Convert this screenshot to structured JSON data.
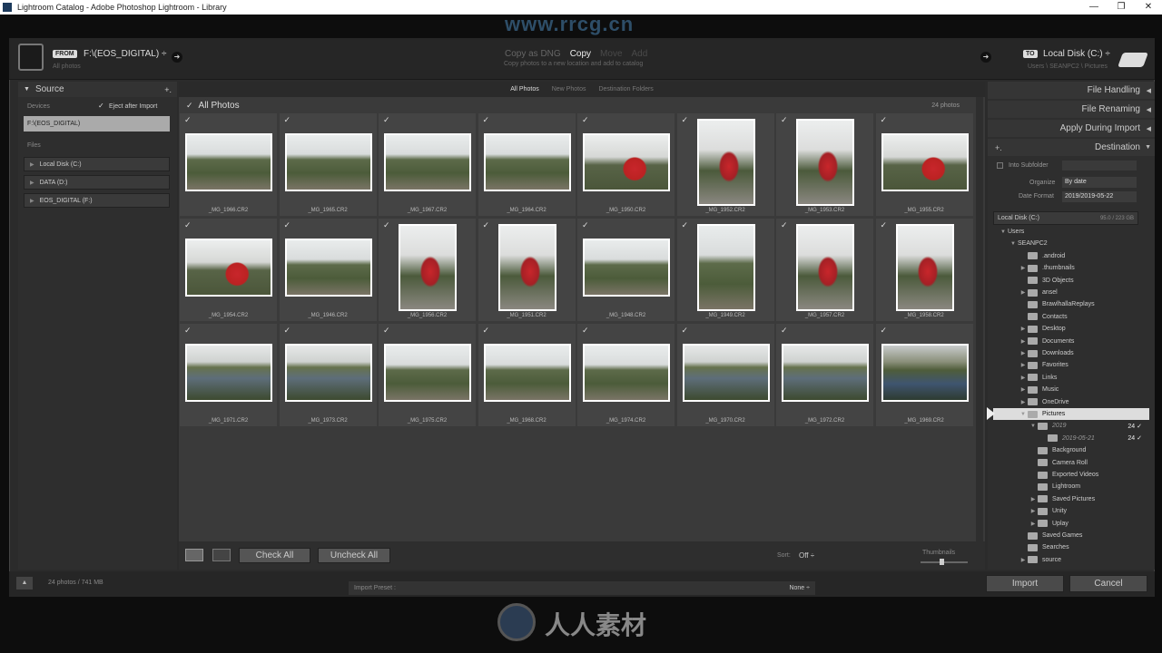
{
  "window": {
    "title": "Lightroom Catalog - Adobe Photoshop Lightroom - Library",
    "controls": [
      "—",
      "❐",
      "✕"
    ]
  },
  "watermark": {
    "top": "www.rrcg.cn",
    "bottom": "人人素材"
  },
  "topbar": {
    "from_tag": "FROM",
    "from_path": "F:\\(EOS_DIGITAL) ÷",
    "from_sub": "All photos",
    "modes": [
      "Copy as DNG",
      "Copy",
      "Move",
      "Add"
    ],
    "mode_desc": "Copy photos to a new location and add to catalog",
    "to_tag": "TO",
    "to_path": "Local Disk (C:) ÷",
    "to_sub": "Users \\ SEANPC2 \\ Pictures"
  },
  "source": {
    "title": "Source",
    "plus": "+.",
    "devices_label": "Devices",
    "eject_label": "Eject after Import",
    "selected_device": "F:\\(EOS_DIGITAL)",
    "files_label": "Files",
    "volumes": [
      "Local Disk (C:)",
      "DATA (D:)",
      "EOS_DIGITAL (F:)"
    ]
  },
  "center": {
    "tabs": [
      "All Photos",
      "New Photos",
      "Destination Folders"
    ],
    "header": "All Photos",
    "count": "24 photos",
    "photos": [
      {
        "name": "_MG_1966.CR2",
        "kind": "land",
        "look": "sky"
      },
      {
        "name": "_MG_1965.CR2",
        "kind": "land",
        "look": "sky"
      },
      {
        "name": "_MG_1967.CR2",
        "kind": "land",
        "look": "sky"
      },
      {
        "name": "_MG_1964.CR2",
        "kind": "land",
        "look": "sky"
      },
      {
        "name": "_MG_1950.CR2",
        "kind": "land",
        "look": "person"
      },
      {
        "name": "_MG_1952.CR2",
        "kind": "port",
        "look": "portp"
      },
      {
        "name": "_MG_1953.CR2",
        "kind": "port",
        "look": "portp"
      },
      {
        "name": "_MG_1955.CR2",
        "kind": "land",
        "look": "person"
      },
      {
        "name": "_MG_1954.CR2",
        "kind": "land",
        "look": "person"
      },
      {
        "name": "_MG_1946.CR2",
        "kind": "land",
        "look": "sky"
      },
      {
        "name": "_MG_1956.CR2",
        "kind": "port",
        "look": "portp"
      },
      {
        "name": "_MG_1951.CR2",
        "kind": "port",
        "look": "portp"
      },
      {
        "name": "_MG_1948.CR2",
        "kind": "land",
        "look": "sky"
      },
      {
        "name": "_MG_1949.CR2",
        "kind": "port",
        "look": "sky"
      },
      {
        "name": "_MG_1957.CR2",
        "kind": "port",
        "look": "portp"
      },
      {
        "name": "_MG_1958.CR2",
        "kind": "port",
        "look": "portp"
      },
      {
        "name": "_MG_1971.CR2",
        "kind": "land",
        "look": "lake"
      },
      {
        "name": "_MG_1973.CR2",
        "kind": "land",
        "look": "lake"
      },
      {
        "name": "_MG_1975.CR2",
        "kind": "land",
        "look": "sky"
      },
      {
        "name": "_MG_1968.CR2",
        "kind": "land",
        "look": "sky"
      },
      {
        "name": "_MG_1974.CR2",
        "kind": "land",
        "look": "sky"
      },
      {
        "name": "_MG_1970.CR2",
        "kind": "land",
        "look": "lake"
      },
      {
        "name": "_MG_1972.CR2",
        "kind": "land",
        "look": "lake"
      },
      {
        "name": "_MG_1969.CR2",
        "kind": "land",
        "look": "blue"
      }
    ],
    "check_all": "Check All",
    "uncheck_all": "Uncheck All",
    "sort_label": "Sort:",
    "sort_value": "Off ÷",
    "thumbnails_label": "Thumbnails"
  },
  "right": {
    "file_handling": "File Handling",
    "file_renaming": "File Renaming",
    "apply_during_import": "Apply During Import",
    "destination": "Destination",
    "into_subfolder": "Into Subfolder",
    "organize_label": "Organize",
    "organize_value": "By date",
    "date_format_label": "Date Format",
    "date_format_value": "2019/2019-05-22",
    "disk": "Local Disk (C:)",
    "disk_space": "95.0 / 223 GB",
    "tree": [
      {
        "label": "Users",
        "depth": 0,
        "arrow": "▼",
        "folder": false
      },
      {
        "label": "SEANPC2",
        "depth": 1,
        "arrow": "▼",
        "folder": false
      },
      {
        "label": ".android",
        "depth": 2,
        "arrow": "",
        "folder": true
      },
      {
        "label": ".thumbnails",
        "depth": 2,
        "arrow": "▶",
        "folder": true
      },
      {
        "label": "3D Objects",
        "depth": 2,
        "arrow": "",
        "folder": true
      },
      {
        "label": "ansel",
        "depth": 2,
        "arrow": "▶",
        "folder": true
      },
      {
        "label": "BrawlhallaReplays",
        "depth": 2,
        "arrow": "",
        "folder": true
      },
      {
        "label": "Contacts",
        "depth": 2,
        "arrow": "",
        "folder": true
      },
      {
        "label": "Desktop",
        "depth": 2,
        "arrow": "▶",
        "folder": true
      },
      {
        "label": "Documents",
        "depth": 2,
        "arrow": "▶",
        "folder": true
      },
      {
        "label": "Downloads",
        "depth": 2,
        "arrow": "▶",
        "folder": true
      },
      {
        "label": "Favorites",
        "depth": 2,
        "arrow": "▶",
        "folder": true
      },
      {
        "label": "Links",
        "depth": 2,
        "arrow": "▶",
        "folder": true
      },
      {
        "label": "Music",
        "depth": 2,
        "arrow": "▶",
        "folder": true
      },
      {
        "label": "OneDrive",
        "depth": 2,
        "arrow": "▶",
        "folder": true
      },
      {
        "label": "Pictures",
        "depth": 2,
        "arrow": "▼",
        "folder": true,
        "selected": true
      },
      {
        "label": "2019",
        "depth": 3,
        "arrow": "▼",
        "folder": true,
        "count": "24 ✓",
        "italic": true
      },
      {
        "label": "2019-05-21",
        "depth": 4,
        "arrow": "",
        "folder": true,
        "count": "24 ✓",
        "italic": true
      },
      {
        "label": "Background",
        "depth": 3,
        "arrow": "",
        "folder": true
      },
      {
        "label": "Camera Roll",
        "depth": 3,
        "arrow": "",
        "folder": true
      },
      {
        "label": "Exported Videos",
        "depth": 3,
        "arrow": "",
        "folder": true
      },
      {
        "label": "Lightroom",
        "depth": 3,
        "arrow": "",
        "folder": true
      },
      {
        "label": "Saved Pictures",
        "depth": 3,
        "arrow": "▶",
        "folder": true
      },
      {
        "label": "Unity",
        "depth": 3,
        "arrow": "▶",
        "folder": true
      },
      {
        "label": "Uplay",
        "depth": 3,
        "arrow": "▶",
        "folder": true
      },
      {
        "label": "Saved Games",
        "depth": 2,
        "arrow": "",
        "folder": true
      },
      {
        "label": "Searches",
        "depth": 2,
        "arrow": "",
        "folder": true
      },
      {
        "label": "source",
        "depth": 2,
        "arrow": "▶",
        "folder": true
      }
    ]
  },
  "bottom": {
    "summary": "24 photos / 741 MB",
    "preset_label": "Import Preset :",
    "preset_value": "None ÷",
    "import": "Import",
    "cancel": "Cancel"
  }
}
